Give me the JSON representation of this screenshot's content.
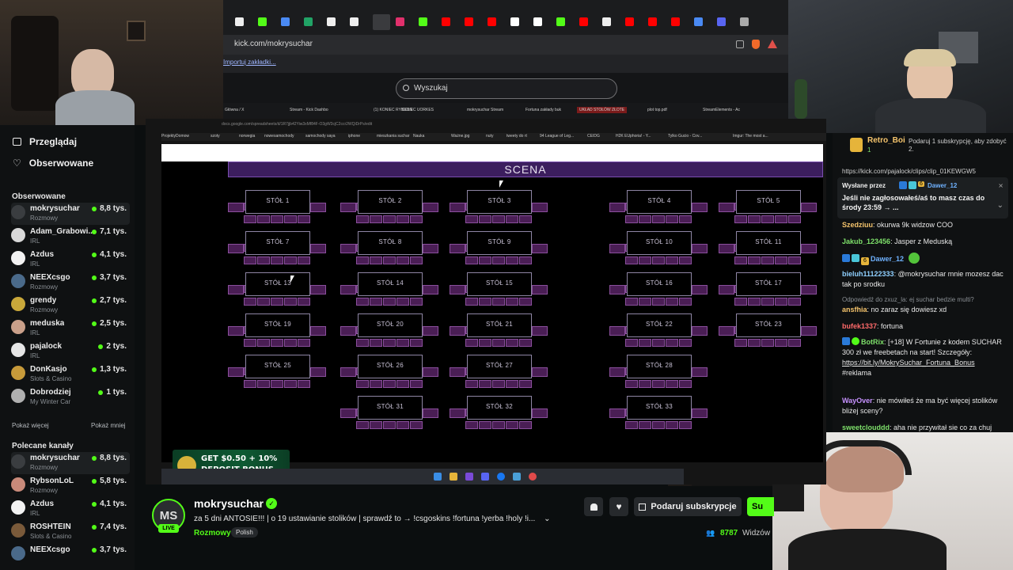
{
  "browser": {
    "tab_icons": [
      "x-icon",
      "kick-icon",
      "docs-icon",
      "sheets-icon",
      "x-icon",
      "x-icon",
      "close-icon",
      "instagram-icon",
      "kick-icon",
      "youtube-icon",
      "youtube-icon",
      "youtube-icon",
      "google-icon",
      "google-icon",
      "kick-icon",
      "youtube-icon",
      "x-icon",
      "youtube-icon",
      "youtube-icon",
      "youtube-icon",
      "docs-icon",
      "discord-icon",
      "chrome-icon"
    ],
    "url": "kick.com/mokrysuchar",
    "bookmark": "Importuj zakładki...",
    "search_placeholder": "Wyszukaj"
  },
  "inner_tabs": [
    "Główna / X",
    "Stream - Kick Dashbo",
    "(1) KONIEC RYBSON",
    "GOLEC UORKES",
    "mokrysuchar Stream",
    "Fortuna zakłady buk",
    "UKŁAD STOŁÓW ZŁOTE",
    "plot top.pdf",
    "StreamElements - Ac"
  ],
  "sheet": {
    "url": "docs.google.com/spreadsheets/d/1R7jjb42Yiw3xMf84F-O3gW3cjC2ccr2WQiDrPs/edit",
    "bookmarks": [
      "ProjektyDomow",
      "szoty",
      "norwegia",
      "nowesamochody",
      "samochody saya",
      "iphone",
      "mieszkania suchar",
      "Nauka",
      "Ważne.jpg",
      "nuty",
      "tweety do rt",
      "94 League of Leg...",
      "CEIDG",
      "H2K EUphoria! - Y...",
      "Tylko Gucio - Cov...",
      "Imgur: The most a..."
    ],
    "stage": "SCENA",
    "tables": [
      "STÓŁ 1",
      "STÓŁ 2",
      "STÓŁ 3",
      "STÓŁ 4",
      "STÓŁ 5",
      "STÓŁ 7",
      "STÓŁ 8",
      "STÓŁ 9",
      "STÓŁ 10",
      "STÓŁ 11",
      "STÓŁ 13",
      "STÓŁ 14",
      "STÓŁ 15",
      "STÓŁ 16",
      "STÓŁ 17",
      "STÓŁ 19",
      "STÓŁ 20",
      "STÓŁ 21",
      "STÓŁ 22",
      "STÓŁ 23",
      "STÓŁ 25",
      "STÓŁ 26",
      "STÓŁ 27",
      "STÓŁ 28",
      "STÓŁ 31",
      "STÓŁ 32",
      "STÓŁ 33"
    ],
    "promo_line1": "GET $0.50 + 10%",
    "promo_line2": "DEPOSIT BONUS"
  },
  "sidebar": {
    "browse": "Przeglądaj",
    "followed_nav": "Obserwowane",
    "followed_title": "Obserwowane",
    "followed": [
      {
        "name": "mokrysuchar",
        "category": "Rozmowy",
        "viewers": "8,8 tys.",
        "color": "#3a3d40"
      },
      {
        "name": "Adam_Grabowi...",
        "category": "IRL",
        "viewers": "7,1 tys.",
        "color": "#d8d8d8"
      },
      {
        "name": "Azdus",
        "category": "IRL",
        "viewers": "4,1 tys.",
        "color": "#f2f2f2"
      },
      {
        "name": "NEEXcsgo",
        "category": "Rozmowy",
        "viewers": "3,7 tys.",
        "color": "#4a6a8a"
      },
      {
        "name": "grendy",
        "category": "Rozmowy",
        "viewers": "2,7 tys.",
        "color": "#c9a83a"
      },
      {
        "name": "meduska",
        "category": "IRL",
        "viewers": "2,5 tys.",
        "color": "#caa08a"
      },
      {
        "name": "pajalock",
        "category": "IRL",
        "viewers": "2 tys.",
        "color": "#e6e6e6"
      },
      {
        "name": "DonKasjo",
        "category": "Slots & Casino",
        "viewers": "1,3 tys.",
        "color": "#c79a3a"
      },
      {
        "name": "Dobrodziej",
        "category": "My Winter Car",
        "viewers": "1 tys.",
        "color": "#b0b0b0"
      }
    ],
    "show_more": "Pokaż więcej",
    "show_less": "Pokaż mniej",
    "recommended_title": "Polecane kanały",
    "recommended": [
      {
        "name": "mokrysuchar",
        "category": "Rozmowy",
        "viewers": "8,8 tys.",
        "color": "#3a3d40"
      },
      {
        "name": "RybsonLoL",
        "category": "Rozmowy",
        "viewers": "5,8 tys.",
        "color": "#c98a7a"
      },
      {
        "name": "Azdus",
        "category": "IRL",
        "viewers": "4,1 tys.",
        "color": "#f2f2f2"
      },
      {
        "name": "ROSHTEIN",
        "category": "Slots & Casino",
        "viewers": "7,4 tys.",
        "color": "#7a5a3a"
      },
      {
        "name": "NEEXcsgo",
        "category": "",
        "viewers": "3,7 tys.",
        "color": "#4a6a8a"
      }
    ]
  },
  "stream": {
    "avatar_initials": "MS",
    "live": "LIVE",
    "name": "mokrysuchar",
    "title": "za 5 dni ANTOSIE!!! | o 19 ustawianie stolików | sprawdź to → !csgoskins !fortuna !yerba !holy !i...",
    "category": "Rozmowy",
    "tag": "Polish",
    "subscribe_gift": "Podaruj subskrypcje",
    "follow_partial": "Su",
    "viewers_count": "8787",
    "viewers_label": "Widzów"
  },
  "chat": {
    "gift_user": "Retro_Boi",
    "gift_count": "1",
    "gift_text": "Podaruj 1 subskrypcję, aby zdobyć 2.",
    "link_cut": "https://kick.com/pajalock/clips/clip_01KEWGW5",
    "pinned_by_label": "Wysłane przez",
    "pinned_by_user": "Dawer_12",
    "pinned_badge": "6",
    "pinned_text": "Jeśli nie zagłosowałeś/aś to masz czas do środy 23:59 → ...",
    "messages": [
      {
        "user": "Szedziuu",
        "user_color": "#f5c46c",
        "text": "okurwa 9k widzow COO"
      },
      {
        "user": "Jakub_123456",
        "user_color": "#7ee06a",
        "text": "Jasper z Meduską"
      },
      {
        "user": "Dawer_12",
        "user_color": "#6fb2ff",
        "text": "",
        "badge": "6"
      },
      {
        "user": "bieluh11122333",
        "user_color": "#8fd0ff",
        "text": "@mokrysuchar mnie mozesz dac tak po srodku"
      },
      {
        "reply": "Odpowiedź do zxuz_la: ej suchar bedzie multi?"
      },
      {
        "user": "ansfhia",
        "user_color": "#f5c46c",
        "text": "no zaraz się dowiesz xd"
      },
      {
        "user": "bufek1337",
        "user_color": "#ff6a6a",
        "text": "fortuna"
      },
      {
        "user": "BotRix",
        "user_color": "#7ee06a",
        "text": "[+18] W Fortunie z kodem SUCHAR 300 zł we freebetach na start! Szczegóły:",
        "link": "https://bit.ly/MokrySuchar_Fortuna_Bonus",
        "extra": "#reklama"
      },
      {
        "user": "WayOver",
        "user_color": "#c792ff",
        "text": "nie mówiłeś że ma być więcej stolików bliżej sceny?"
      },
      {
        "user": "sweetclouddd",
        "user_color": "#7ee06a",
        "text": "aha nie przywitał sie co za chuj"
      }
    ]
  }
}
